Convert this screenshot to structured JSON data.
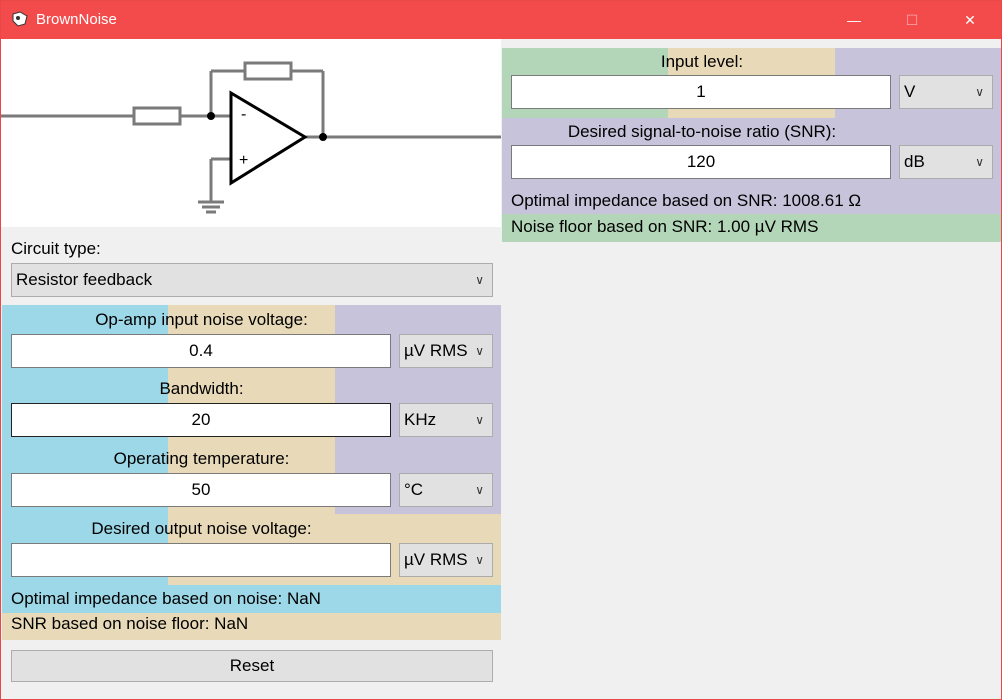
{
  "window": {
    "title": "BrownNoise",
    "minimize": "—",
    "maximize": "☐",
    "close": "✕"
  },
  "circuit": {
    "plus": "+",
    "minus": "-"
  },
  "input_level": {
    "label": "Input level:",
    "value": "1",
    "unit": "V"
  },
  "snr": {
    "label": "Desired signal-to-noise ratio (SNR):",
    "value": "120",
    "unit": "dB"
  },
  "results_right": {
    "optimal_impedance": "Optimal impedance based on SNR: 1008.61 Ω",
    "noise_floor": "Noise floor based on SNR: 1.00 µV RMS"
  },
  "circuit_type": {
    "label": "Circuit type:",
    "value": "Resistor feedback"
  },
  "opamp_noise": {
    "label": "Op-amp input noise voltage:",
    "value": "0.4",
    "unit": "µV RMS"
  },
  "bandwidth": {
    "label": "Bandwidth:",
    "value": "20",
    "unit": "KHz"
  },
  "temperature": {
    "label": "Operating temperature:",
    "value": "50",
    "unit": "°C"
  },
  "output_noise": {
    "label": "Desired output noise voltage:",
    "value": "",
    "unit": "µV RMS"
  },
  "results_left": {
    "optimal_impedance": "Optimal impedance based on noise: NaN",
    "snr_floor": "SNR based on noise floor: NaN"
  },
  "reset_label": "Reset",
  "colors": {
    "titlebar": "#f34b4b",
    "green": "#b4d6b8",
    "tan": "#e8dab8",
    "purple": "#c6c3da",
    "blue": "#9dd8e8"
  }
}
